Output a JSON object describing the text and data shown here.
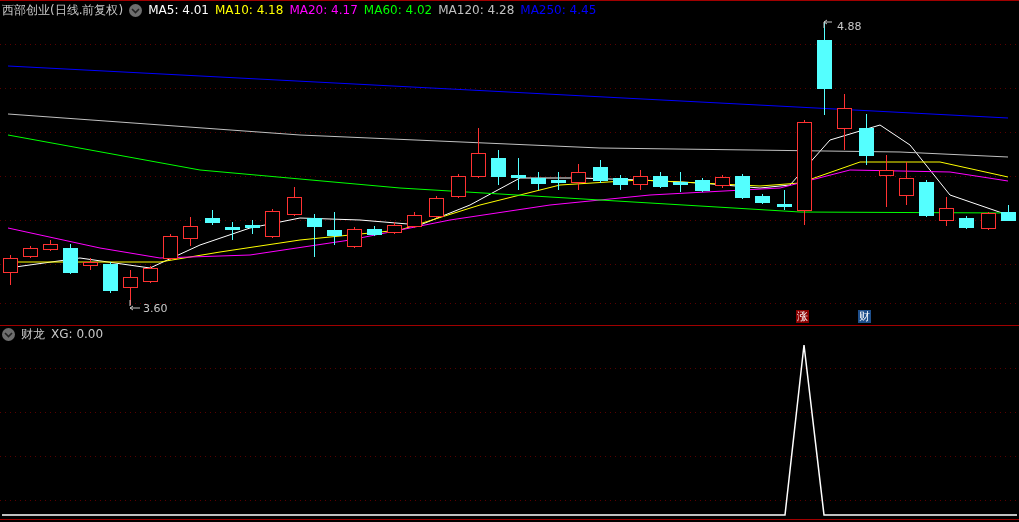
{
  "main_chart": {
    "title": "西部创业(日线.前复权)",
    "moving_averages": [
      {
        "label": "MA5: 4.01",
        "color": "#ffffff"
      },
      {
        "label": "MA10: 4.18",
        "color": "#ffff00"
      },
      {
        "label": "MA20: 4.17",
        "color": "#ff00ff"
      },
      {
        "label": "MA60: 4.02",
        "color": "#00ff00"
      },
      {
        "label": "MA120: 4.28",
        "color": "#c0c0c0"
      },
      {
        "label": "MA250: 4.45",
        "color": "#0000ff"
      }
    ],
    "high_label": "4.88",
    "low_label": "3.60",
    "signals": [
      {
        "text": "涨",
        "color": "#8b0000"
      },
      {
        "text": "财",
        "color": "#1e4f8c"
      }
    ]
  },
  "indicator": {
    "title": "财龙",
    "reading": "XG: 0.00"
  }
}
